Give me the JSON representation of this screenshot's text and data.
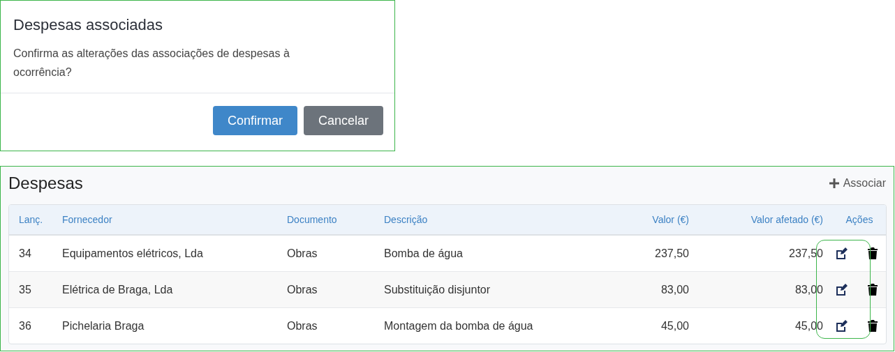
{
  "dialog": {
    "title": "Despesas associadas",
    "message": "Confirma as alterações das associações de despesas à ocorrência?",
    "buttons": [
      {
        "label": "Confirmar",
        "kind": "primary"
      },
      {
        "label": "Cancelar",
        "kind": "secondary"
      }
    ]
  },
  "panel": {
    "title": "Despesas",
    "action_button": {
      "label": "Associar"
    },
    "table": {
      "columns": [
        {
          "label": "Lanç.",
          "kind": "text"
        },
        {
          "label": "Fornecedor",
          "kind": "text"
        },
        {
          "label": "Documento",
          "kind": "text"
        },
        {
          "label": "Descrição",
          "kind": "text"
        },
        {
          "label": "Valor (€)",
          "kind": "amount"
        },
        {
          "label": "Valor afetado (€)",
          "kind": "amount"
        },
        {
          "label": "Ações",
          "kind": "actions"
        }
      ],
      "rows": [
        {
          "cells": [
            "34",
            "Equipamentos elétricos, Lda",
            "Obras",
            "Bomba de água",
            "237,50",
            "237,50"
          ]
        },
        {
          "cells": [
            "35",
            "Elétrica de Braga, Lda",
            "Obras",
            "Substituição disjuntor",
            "83,00",
            "83,00"
          ]
        },
        {
          "cells": [
            "36",
            "Pichelaria Braga",
            "Obras",
            "Montagem da bomba de água",
            "45,00",
            "45,00"
          ]
        }
      ]
    }
  }
}
